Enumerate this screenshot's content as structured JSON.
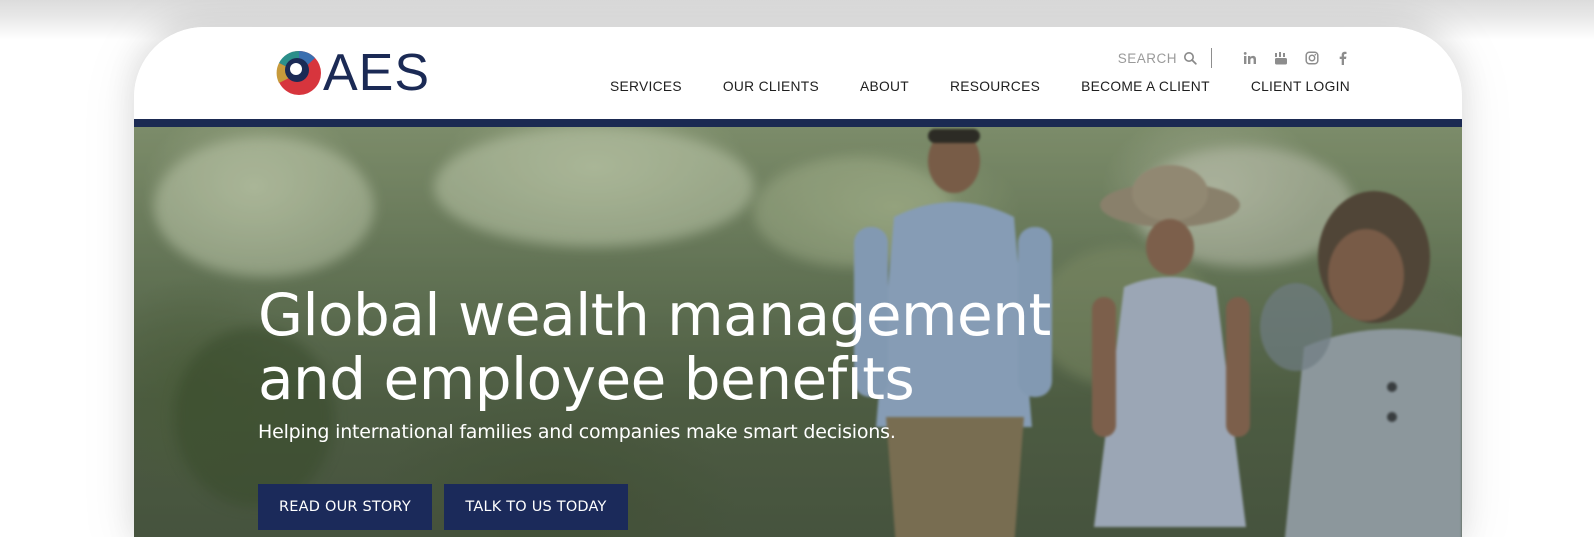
{
  "brand": {
    "name": "AES",
    "colors": {
      "navy": "#1b2a55",
      "red": "#d7353d",
      "teal": "#2b8f8a",
      "gold": "#c79a3b"
    }
  },
  "utility": {
    "search_label": "SEARCH",
    "search_icon": "search-icon",
    "social": [
      {
        "name": "linkedin",
        "glyph": "in"
      },
      {
        "name": "youtube",
        "glyph": "youtube-icon"
      },
      {
        "name": "instagram",
        "glyph": "instagram-icon"
      },
      {
        "name": "facebook",
        "glyph": "f"
      }
    ]
  },
  "nav": {
    "items": [
      {
        "label": "SERVICES"
      },
      {
        "label": "OUR CLIENTS"
      },
      {
        "label": "ABOUT"
      },
      {
        "label": "RESOURCES"
      },
      {
        "label": "BECOME A CLIENT"
      },
      {
        "label": "CLIENT LOGIN"
      }
    ]
  },
  "hero": {
    "title_line1": "Global wealth management",
    "title_line2": "and employee benefits",
    "subtitle": "Helping international families and companies make smart decisions.",
    "primary_button": "READ OUR STORY",
    "secondary_button": "TALK TO US TODAY"
  }
}
